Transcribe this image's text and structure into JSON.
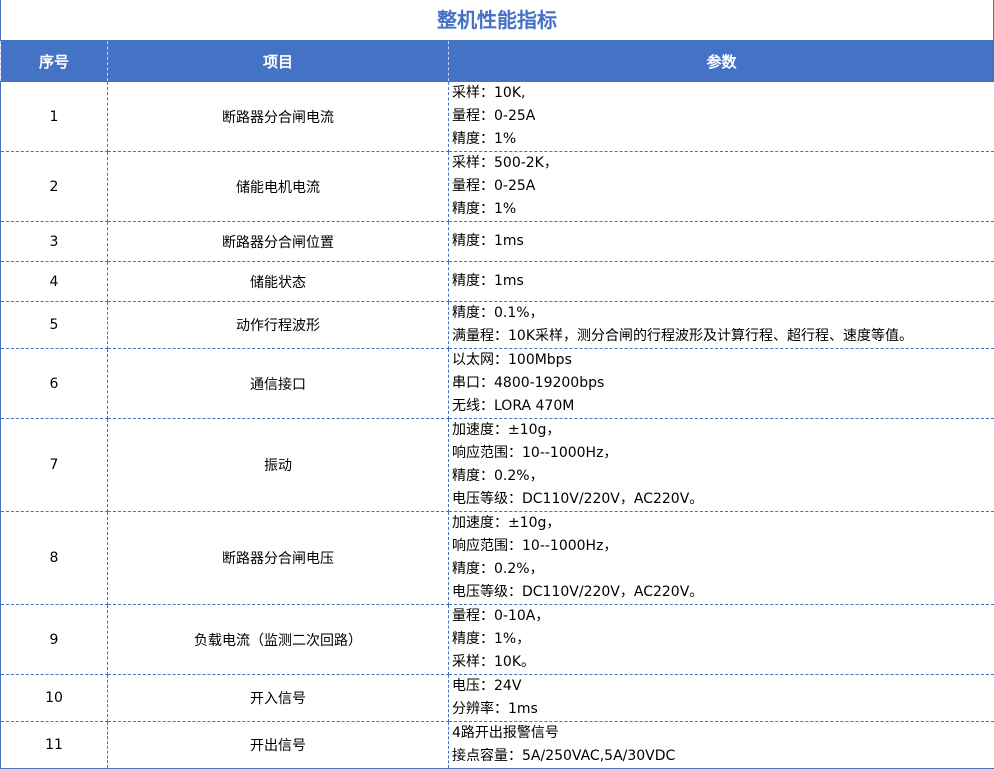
{
  "title": "整机性能指标",
  "headers": [
    "序号",
    "项目",
    "参数"
  ],
  "rows": [
    {
      "no": "1",
      "item": "断路器分合闸电流",
      "params": [
        "采样：10K,",
        "量程：0-25A",
        "精度：1%"
      ]
    },
    {
      "no": "2",
      "item": "储能电机电流",
      "params": [
        "采样：500-2K，",
        "量程：0-25A",
        "精度：1%"
      ]
    },
    {
      "no": "3",
      "item": "断路器分合闸位置",
      "params": [
        "精度：1ms"
      ]
    },
    {
      "no": "4",
      "item": "储能状态",
      "params": [
        "精度：1ms"
      ]
    },
    {
      "no": "5",
      "item": "动作行程波形",
      "params": [
        "精度：0.1%，",
        "满量程：10K采样，测分合闸的行程波形及计算行程、超行程、速度等值。"
      ]
    },
    {
      "no": "6",
      "item": "通信接口",
      "params": [
        "以太网：100Mbps",
        "串口：4800-19200bps",
        "无线：LORA 470M"
      ]
    },
    {
      "no": "7",
      "item": "振动",
      "params": [
        "加速度：±10g，",
        "响应范围：10--1000Hz，",
        "精度：0.2%，",
        "电压等级：DC110V/220V，AC220V。"
      ]
    },
    {
      "no": "8",
      "item": "断路器分合闸电压",
      "params": [
        "加速度：±10g，",
        "响应范围：10--1000Hz，",
        "精度：0.2%，",
        "电压等级：DC110V/220V，AC220V。"
      ]
    },
    {
      "no": "9",
      "item": "负载电流（监测二次回路）",
      "params": [
        "量程：0-10A，",
        "精度：1%，",
        "采样：10K。"
      ]
    },
    {
      "no": "10",
      "item": "开入信号",
      "params": [
        "电压：24V",
        "分辨率：1ms"
      ]
    },
    {
      "no": "11",
      "item": "开出信号",
      "params": [
        "4路开出报警信号",
        "接点容量：5A/250VAC,5A/30VDC"
      ]
    }
  ]
}
